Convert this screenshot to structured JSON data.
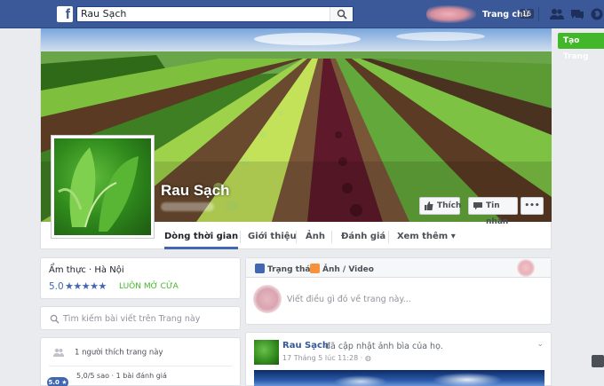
{
  "topbar": {
    "logo": "f",
    "search_value": "Rau Sạch",
    "home_label": "Trang chủ",
    "home_count": "15",
    "icons": [
      "friends-icon",
      "messages-icon",
      "globe-icon"
    ]
  },
  "create_page_label": "Tạo Trang",
  "page": {
    "name": "Rau Sạch",
    "like_label": "Thích",
    "message_label": "Tin nhắn",
    "more_label": "•••"
  },
  "tabs": [
    {
      "label": "Dòng thời gian"
    },
    {
      "label": "Giới thiệu"
    },
    {
      "label": "Ảnh"
    },
    {
      "label": "Đánh giá"
    },
    {
      "label": "Xem thêm ▾"
    }
  ],
  "about": {
    "category": "Ẩm thực · Hà Nội",
    "rating": "5.0",
    "stars": "★★★★★",
    "status": "LUÔN MỞ CỬA"
  },
  "search_page_placeholder": "Tìm kiếm bài viết trên Trang này",
  "stats": {
    "likes": "1 người thích trang này",
    "rating_badge": "5.0 ★",
    "review_line": "5,0/5 sao · 1 bài đánh giá"
  },
  "composer": {
    "status_tab": "Trạng thái",
    "photo_tab": "Ảnh / Video",
    "placeholder": "Viết điều gì đó về trang này..."
  },
  "post": {
    "author": "Rau Sạch",
    "action": "đã cập nhật ảnh bìa của họ.",
    "time": "17 Tháng 5 lúc 11:28 · ",
    "chevron": "⌄"
  },
  "colors": {
    "facebook_blue": "#3b5998",
    "link_blue": "#4267b2",
    "green": "#42b72a"
  }
}
